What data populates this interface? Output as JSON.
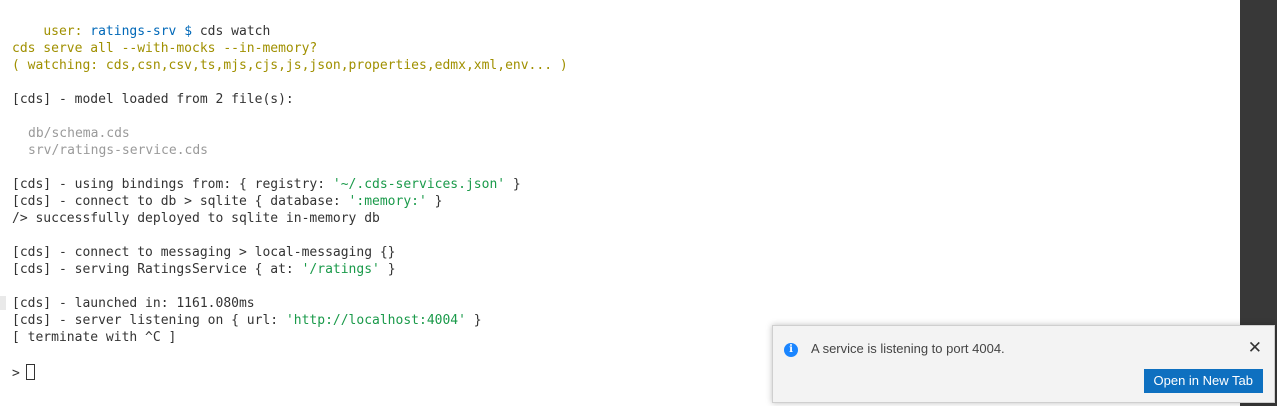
{
  "terminal": {
    "prompt": {
      "user": "user:",
      "dir": "ratings-srv",
      "symbol": "$",
      "command": "cds watch"
    },
    "serve_line": "cds serve all --with-mocks --in-memory?",
    "watch_line": "( watching: cds,csn,csv,ts,mjs,cjs,js,json,properties,edmx,xml,env... )",
    "model_loaded": "[cds] - model loaded from 2 file(s):",
    "files": [
      "db/schema.cds",
      "srv/ratings-service.cds"
    ],
    "bindings_pre": "[cds] - using bindings from: { registry: ",
    "bindings_val": "'~/.cds-services.json'",
    "bindings_post": " }",
    "connect_db_pre": "[cds] - connect to db > sqlite { database: ",
    "connect_db_val": "':memory:'",
    "connect_db_post": " }",
    "deployed": "/> successfully deployed to sqlite in-memory db",
    "messaging": "[cds] - connect to messaging > local-messaging {}",
    "serving_pre": "[cds] - serving RatingsService { at: ",
    "serving_val": "'/ratings'",
    "serving_post": " }",
    "launched": "[cds] - launched in: 1161.080ms",
    "listening_pre": "[cds] - server listening on { url: ",
    "listening_val": "'http://localhost:4004'",
    "listening_post": " }",
    "terminate": "[ terminate with ^C ]",
    "input_prompt": ">"
  },
  "notification": {
    "icon": "info-icon",
    "icon_glyph": "i",
    "message": "A service is listening to port 4004.",
    "close_glyph": "✕",
    "button_label": "Open in New Tab"
  },
  "colors": {
    "yellow": "#a09000",
    "blue": "#0068b8",
    "string_green": "#1a9a4a",
    "button_blue": "#0e70c0",
    "scrollbar": "#383838"
  }
}
